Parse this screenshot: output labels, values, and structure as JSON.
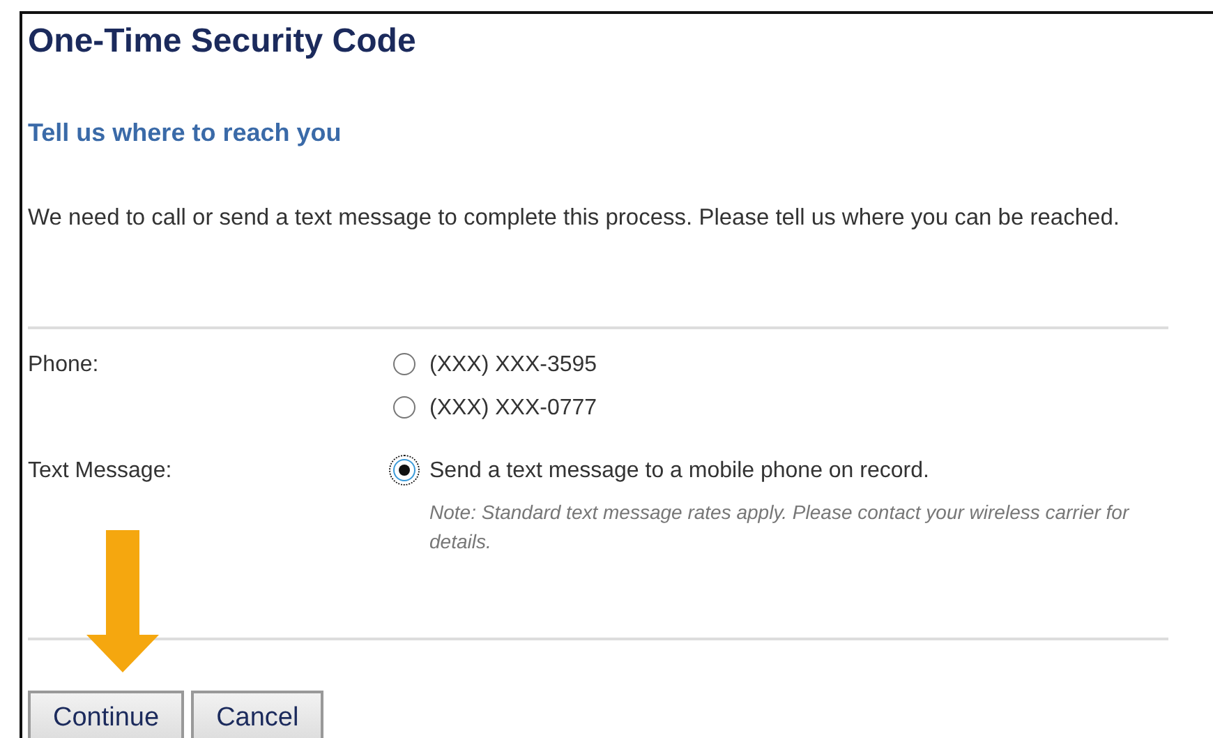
{
  "title": "One-Time Security Code",
  "subtitle": "Tell us where to reach you",
  "intro": "We need to call or send a text message to complete this process. Please tell us where you can be reached.",
  "groups": [
    {
      "label": "Phone:",
      "choices": [
        {
          "text": "(XXX) XXX-3595",
          "selected": false,
          "focused": false
        },
        {
          "text": "(XXX) XXX-0777",
          "selected": false,
          "focused": false
        }
      ]
    },
    {
      "label": "Text Message:",
      "choices": [
        {
          "text": "Send a text message to a mobile phone on record.",
          "selected": true,
          "focused": true,
          "note": "Note: Standard text message rates apply. Please contact your wireless carrier for details."
        }
      ]
    }
  ],
  "buttons": [
    "Continue",
    "Cancel"
  ]
}
